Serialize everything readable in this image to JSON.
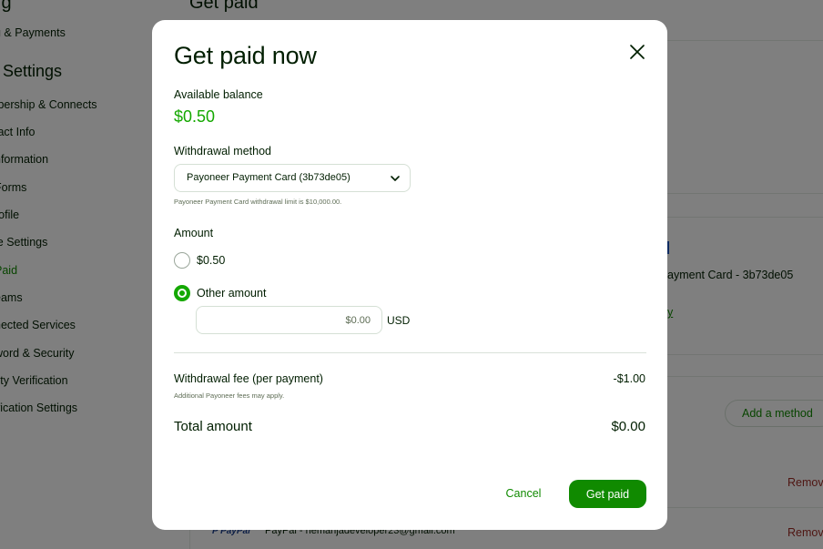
{
  "background": {
    "top_left_heading": "ıg",
    "top_title": "Get paid",
    "sidebar": {
      "first_item": "g & Payments",
      "heading": "r Settings",
      "items": [
        "ıbership & Connects",
        "tact Info",
        "nformation",
        "Forms",
        "rofile",
        "le Settings",
        "Paid",
        "eams",
        "nected Services",
        "word & Security",
        "tity Verification",
        "ification Settings"
      ]
    },
    "method_text": "ayment Card - 3b73de05",
    "link_fragment": "y",
    "add_method_label": "Add a method",
    "remove_label": "Remov",
    "paypal_logo": "P PayPal",
    "paypal_text": "PayPal - nemanjadeveloper23@gmail.com"
  },
  "modal": {
    "title": "Get paid now",
    "available_balance_label": "Available balance",
    "available_balance": "$0.50",
    "withdrawal_method_label": "Withdrawal method",
    "withdrawal_method_selected": "Payoneer Payment Card (3b73de05)",
    "withdrawal_limit_hint": "Payoneer Payment Card withdrawal limit is $10,000.00.",
    "amount_label": "Amount",
    "option_balance_label": "$0.50",
    "option_other_label": "Other amount",
    "amount_placeholder": "$0.00",
    "currency": "USD",
    "fee_label": "Withdrawal fee (per payment)",
    "fee_value": "-$1.00",
    "fee_note": "Additional Payoneer fees may apply.",
    "total_label": "Total amount",
    "total_value": "$0.00",
    "cancel_label": "Cancel",
    "submit_label": "Get paid"
  },
  "colors": {
    "accent_green": "#108a00",
    "balance_green": "#14a800",
    "overlay": "rgba(0,0,0,0.5)",
    "remove_red": "#9e2b25"
  }
}
